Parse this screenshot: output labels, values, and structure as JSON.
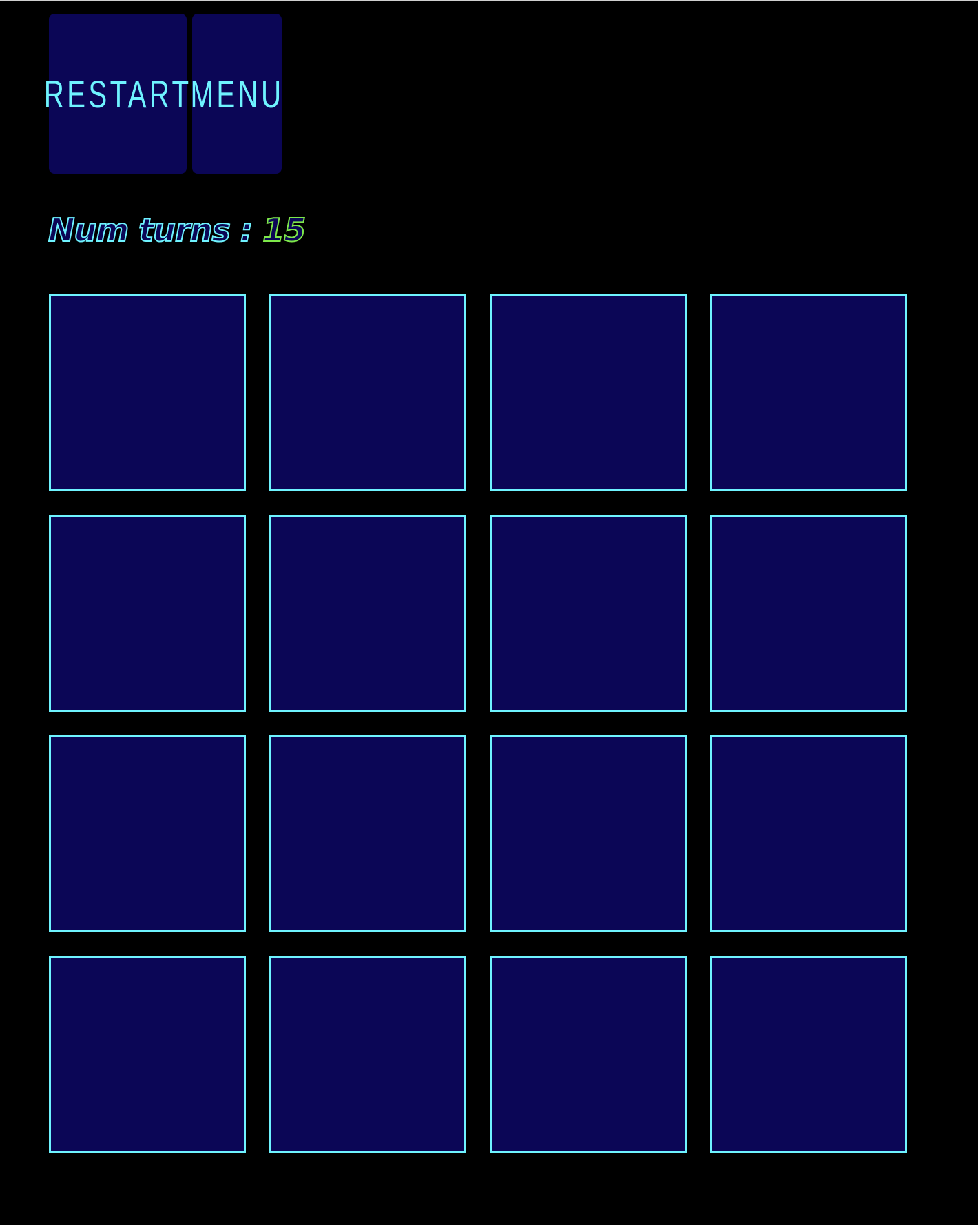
{
  "toolbar": {
    "restart_label": "RESTART",
    "menu_label": "MENU"
  },
  "status": {
    "turns_label": "Num turns :",
    "turns_count": "15"
  },
  "board": {
    "rows": 4,
    "columns": 4,
    "cards_face_down": 16
  },
  "colors": {
    "background": "#000000",
    "card_fill": "#0b0656",
    "accent": "#6ff3ff",
    "count_outline": "#7ee84a"
  }
}
